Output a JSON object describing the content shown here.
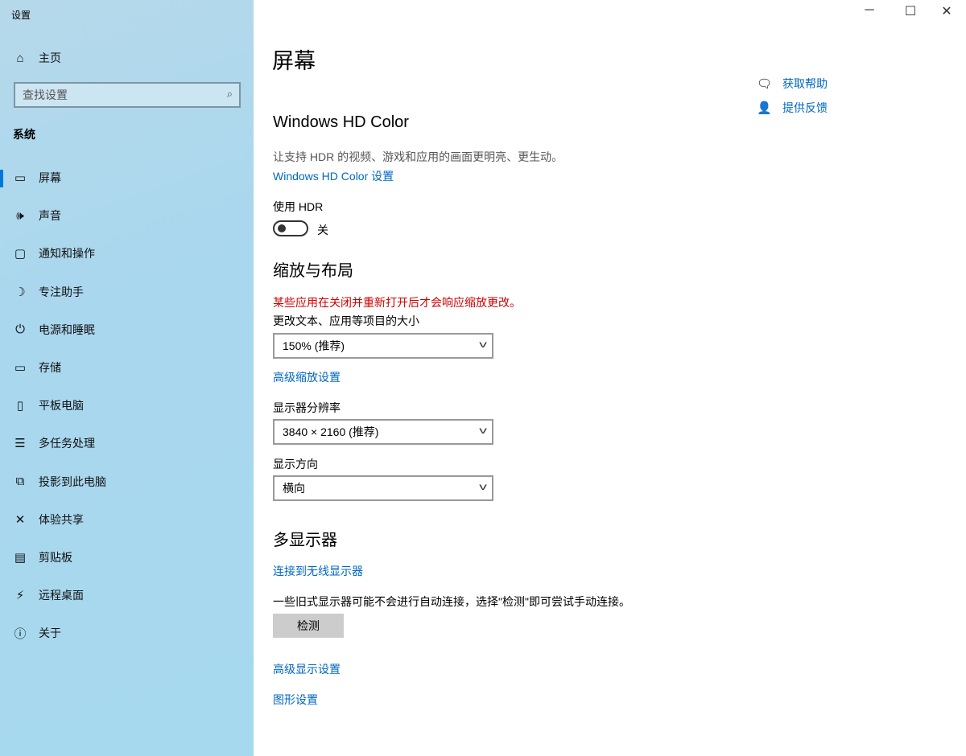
{
  "window": {
    "title": "设置",
    "minimize": "─",
    "maximize": "☐",
    "close": "✕"
  },
  "sidebar": {
    "home": {
      "icon": "⌂",
      "label": "主页"
    },
    "search_placeholder": "查找设置",
    "section": "系统",
    "items": [
      {
        "icon": "▭",
        "label": "屏幕"
      },
      {
        "icon": "🕪",
        "label": "声音"
      },
      {
        "icon": "▢",
        "label": "通知和操作"
      },
      {
        "icon": "☽",
        "label": "专注助手"
      },
      {
        "icon": "⏻",
        "label": "电源和睡眠"
      },
      {
        "icon": "▭",
        "label": "存储"
      },
      {
        "icon": "▯",
        "label": "平板电脑"
      },
      {
        "icon": "☰",
        "label": "多任务处理"
      },
      {
        "icon": "⧉",
        "label": "投影到此电脑"
      },
      {
        "icon": "✕",
        "label": "体验共享"
      },
      {
        "icon": "▤",
        "label": "剪贴板"
      },
      {
        "icon": "⚡",
        "label": "远程桌面"
      },
      {
        "icon": "ⓘ",
        "label": "关于"
      }
    ]
  },
  "main": {
    "title": "屏幕",
    "hd": {
      "heading": "Windows HD Color",
      "desc": "让支持 HDR 的视频、游戏和应用的画面更明亮、更生动。",
      "link": "Windows HD Color 设置",
      "hdr_label": "使用 HDR",
      "hdr_state": "关"
    },
    "scale": {
      "heading": "缩放与布局",
      "warning": "某些应用在关闭并重新打开后才会响应缩放更改。",
      "size_label": "更改文本、应用等项目的大小",
      "size_value": "150% (推荐)",
      "advanced_link": "高级缩放设置",
      "res_label": "显示器分辨率",
      "res_value": "3840 × 2160 (推荐)",
      "orient_label": "显示方向",
      "orient_value": "横向"
    },
    "multi": {
      "heading": "多显示器",
      "wireless_link": "连接到无线显示器",
      "detect_desc": "一些旧式显示器可能不会进行自动连接，选择\"检测\"即可尝试手动连接。",
      "detect_button": "检测",
      "advanced_display_link": "高级显示设置",
      "graphics_link": "图形设置"
    },
    "help": {
      "get_help": "获取帮助",
      "feedback": "提供反馈"
    }
  }
}
